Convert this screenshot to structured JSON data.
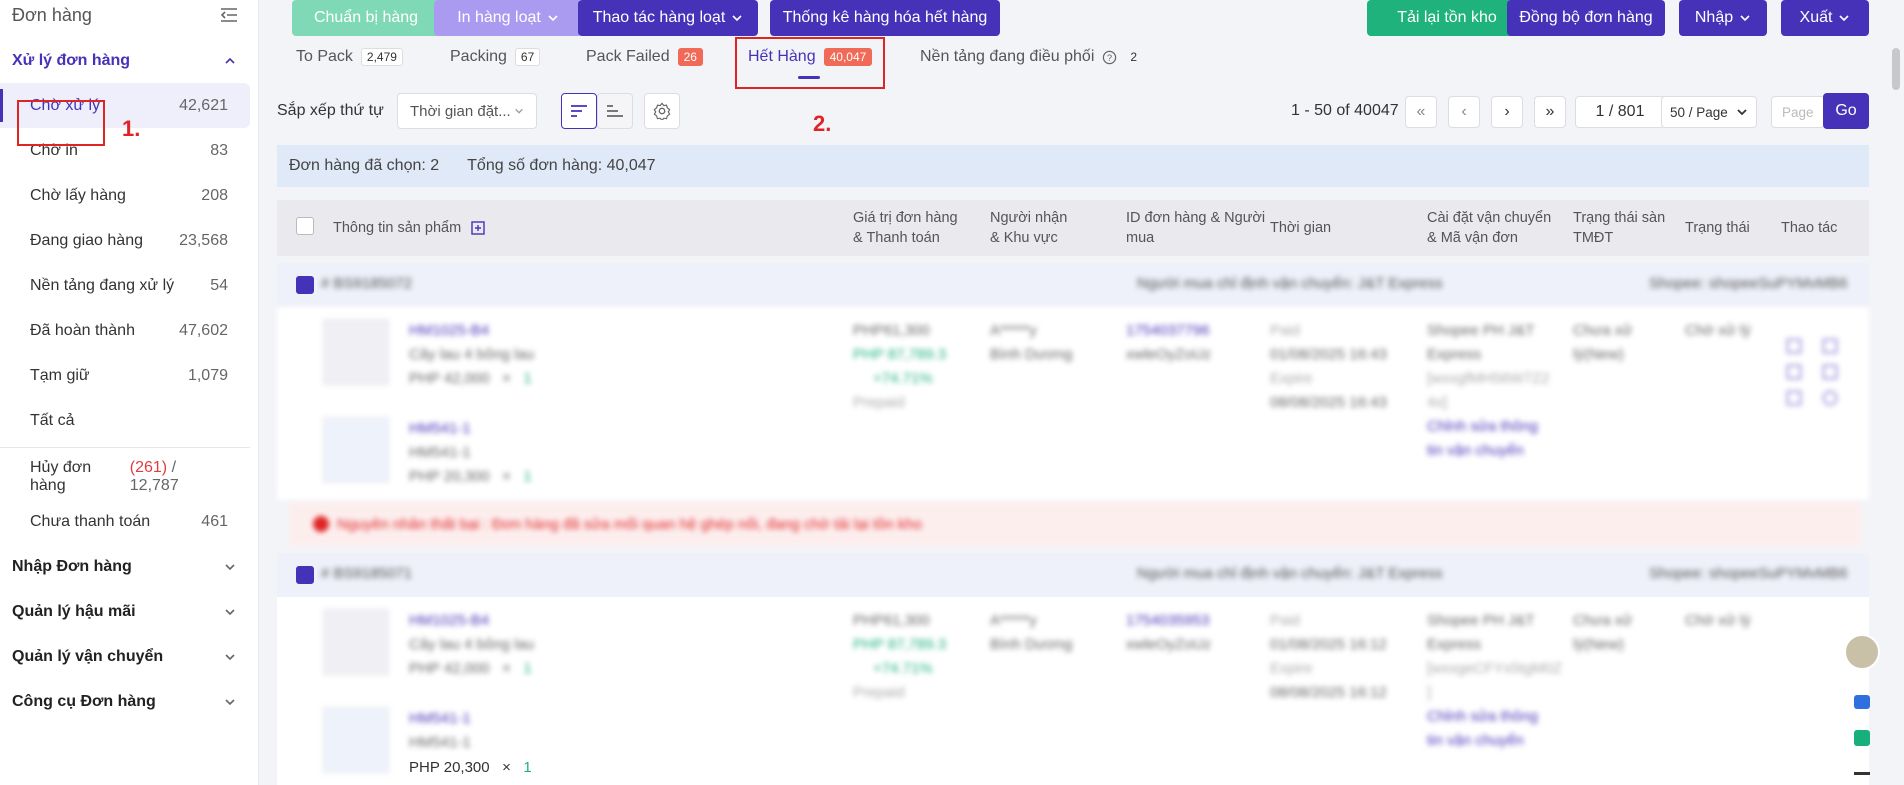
{
  "sidebar": {
    "title": "Đơn hàng",
    "section_active": "Xử lý đơn hàng",
    "items": [
      {
        "label": "Chờ xử lý",
        "count": "42,621"
      },
      {
        "label": "Chờ in",
        "count": "83"
      },
      {
        "label": "Chờ lấy hàng",
        "count": "208"
      },
      {
        "label": "Đang giao hàng",
        "count": "23,568"
      },
      {
        "label": "Nền tảng đang xử lý",
        "count": "54"
      },
      {
        "label": "Đã hoàn thành",
        "count": "47,602"
      },
      {
        "label": "Tạm giữ",
        "count": "1,079"
      },
      {
        "label": "Tất cả",
        "count": ""
      }
    ],
    "cancel": {
      "label": "Hủy đơn hàng",
      "red": "(261)",
      "sep": "/",
      "total": "12,787"
    },
    "unpaid": {
      "label": "Chưa thanh toán",
      "count": "461"
    },
    "sections": [
      "Nhập Đơn hàng",
      "Quản lý hậu mãi",
      "Quản lý vận chuyển",
      "Công cụ Đơn hàng"
    ]
  },
  "toolbar": {
    "prepare": "Chuẩn bị hàng",
    "bulk_print": "In hàng loạt",
    "bulk_action": "Thao tác hàng loạt",
    "stats": "Thống kê hàng hóa hết hàng",
    "reload_stock": "Tải lại tồn kho",
    "sync_orders": "Đồng bộ đơn hàng",
    "import": "Nhập",
    "export": "Xuất"
  },
  "tabs": [
    {
      "label": "To Pack",
      "count": "2,479"
    },
    {
      "label": "Packing",
      "count": "67"
    },
    {
      "label": "Pack Failed",
      "count": "26"
    },
    {
      "label": "Hết Hàng",
      "count": "40,047"
    },
    {
      "label": "Nền tảng đang điều phối",
      "count": "2"
    }
  ],
  "annotations": {
    "one": "1.",
    "two": "2."
  },
  "sort": {
    "label": "Sắp xếp thứ tự",
    "value": "Thời gian đặt..."
  },
  "pager": {
    "range": "1 - 50 of 40047",
    "page": "1 / 801",
    "per_page": "50 / Page",
    "placeholder": "Page",
    "go": "Go"
  },
  "summary": {
    "selected": "Đơn hàng đã chọn: 2",
    "total": "Tổng số đơn hàng: 40,047"
  },
  "table_headers": {
    "product": "Thông tin sản phẩm",
    "value": [
      "Giá trị đơn hàng",
      "& Thanh toán"
    ],
    "receiver": [
      "Người nhận",
      "& Khu vực"
    ],
    "order_id": [
      "ID đơn hàng & Người",
      "mua"
    ],
    "time": "Thời gian",
    "shipping": [
      "Cài đặt vận chuyển",
      "& Mã vận đơn"
    ],
    "platform_status": [
      "Trạng thái sàn",
      "TMĐT"
    ],
    "status": "Trạng thái",
    "actions": "Thao tác"
  },
  "orders": [
    {
      "id": "# BS9185072",
      "carrier_note": "Người mua chỉ định vận chuyển: J&T Express",
      "shop": "Shopee: shopeeSuPYMvMB6",
      "items": [
        {
          "sku": "HM1025-B4",
          "name": "Cây lau 4 bông lau",
          "price": "PHP 42,000",
          "qty_sep": "×",
          "qty": "1"
        },
        {
          "sku": "HM541-1",
          "name": "HM541-1",
          "price": "PHP 20,300",
          "qty_sep": "×",
          "qty": "1"
        }
      ],
      "amount": "PHP61,300",
      "amount2": "PHP 87,789.3",
      "amount3": "+74.71%",
      "payment": "Prepaid",
      "receiver": "A*****y",
      "region": "Bình Dương",
      "order_no": "1754037796",
      "buyer": "xwleOyZoUz",
      "t1": "Paid",
      "t2": "01/08/2025 16:43",
      "t3": "Expire",
      "t4": "08/08/2025 16:43",
      "ship1": "Shopee PH J&T",
      "ship2": "Express",
      "ship3": "[wxxgfMH56W7Z2",
      "ship4": "4x]",
      "edit1": "Chỉnh sửa thông",
      "edit2": "tin vận chuyển",
      "plat1": "Chưa xử",
      "plat2": "lý(New)",
      "status": "Chờ xử lý"
    },
    {
      "id": "# BS9185071",
      "carrier_note": "Người mua chỉ định vận chuyển: J&T Express",
      "shop": "Shopee: shopeeSuPYMvMB6",
      "items": [
        {
          "sku": "HM1025-B4",
          "name": "Cây lau 4 bông lau",
          "price": "PHP 42,000",
          "qty_sep": "×",
          "qty": "1"
        },
        {
          "sku": "HM541-1",
          "name": "HM541-1",
          "price": "PHP 20,300",
          "qty_sep": "×",
          "qty": "1"
        }
      ],
      "amount": "PHP61,300",
      "amount2": "PHP 87,789.3",
      "amount3": "+74.71%",
      "payment": "Prepaid",
      "receiver": "A*****y",
      "region": "Bình Dương",
      "order_no": "1754035953",
      "buyer": "xwleOyZoUz",
      "t1": "Paid",
      "t2": "01/08/2025 16:12",
      "t3": "Expire",
      "t4": "08/08/2025 16:12",
      "ship1": "Shopee PH J&T",
      "ship2": "Express",
      "ship3": "[wxxgeCFYx5tgM0Z",
      "ship4": "]",
      "edit1": "Chỉnh sửa thông",
      "edit2": "tin vận chuyển",
      "plat1": "Chưa xử",
      "plat2": "lý(New)",
      "status": "Chờ xử lý"
    }
  ],
  "fail_reason": "Nguyên nhân thất bại : Đơn hàng đã sửa mối quan hệ ghép nối, đang chờ tải lại tồn kho",
  "colors": {
    "primary": "#4632b8",
    "green": "#1fb27d",
    "danger": "#e02424"
  }
}
